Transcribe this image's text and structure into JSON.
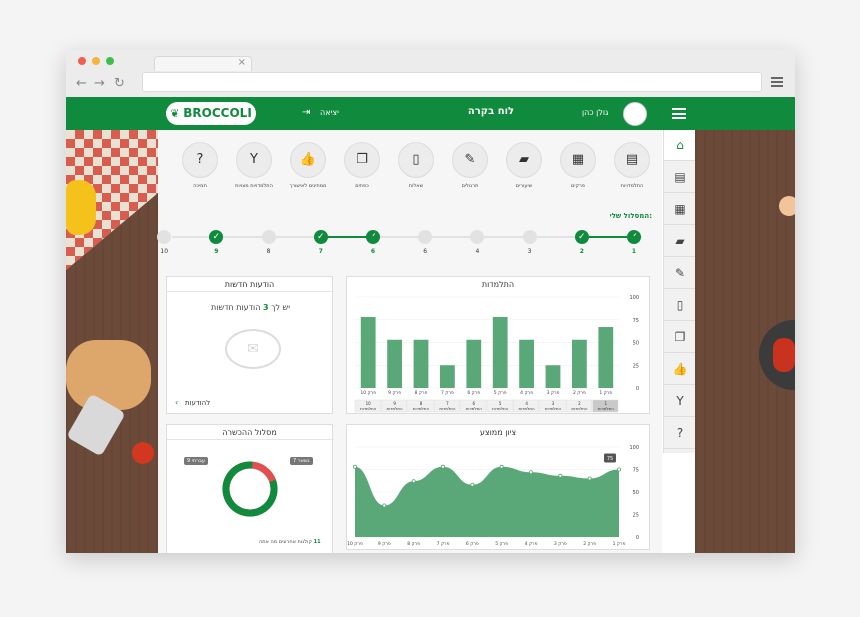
{
  "brand": {
    "name": "BROCCOLI",
    "color": "#108a3d"
  },
  "header": {
    "title": "לוח בקרה",
    "logout_label": "יציאה",
    "user_name": "גולן כהן"
  },
  "sidebar": {
    "icons": [
      "home-icon",
      "card-icon",
      "grid-icon",
      "book-icon",
      "edit-icon",
      "document-icon",
      "copy-icon",
      "thumbs-up-icon",
      "trophy-icon",
      "help-icon"
    ],
    "glyphs": [
      "⌂",
      "▤",
      "▦",
      "▰",
      "✎",
      "▯",
      "❐",
      "👍",
      "Y",
      "?"
    ]
  },
  "shortcuts": [
    {
      "label": "התלמדויות",
      "glyph": "▤"
    },
    {
      "label": "פרקים",
      "glyph": "▦"
    },
    {
      "label": "שיעורים",
      "glyph": "▰"
    },
    {
      "label": "תרגולים",
      "glyph": "✎"
    },
    {
      "label": "שאלות",
      "glyph": "▯"
    },
    {
      "label": "כפתים",
      "glyph": "❐"
    },
    {
      "label": "ממתינים לאישורך",
      "glyph": "👍"
    },
    {
      "label": "התלמדויות מצויות",
      "glyph": "Y"
    },
    {
      "label": "תמיכה",
      "glyph": "?"
    }
  ],
  "path": {
    "title": "המסלול שלי:",
    "steps": [
      {
        "label": "1",
        "done": true
      },
      {
        "label": "2",
        "done": true
      },
      {
        "label": "3",
        "done": false
      },
      {
        "label": "4",
        "done": false
      },
      {
        "label": "6",
        "done": false
      },
      {
        "label": "6",
        "done": true
      },
      {
        "label": "7",
        "done": true
      },
      {
        "label": "8",
        "done": false
      },
      {
        "label": "9",
        "done": true
      },
      {
        "label": "10",
        "done": false
      }
    ]
  },
  "messages": {
    "title": "הודעות חדשות",
    "prefix": "יש לך",
    "count": "3",
    "suffix": "הודעות חדשות",
    "link": "להודעות"
  },
  "bar_chart": {
    "title": "התלמדות",
    "categories": [
      "פרק 1",
      "פרק 2",
      "פרק 3",
      "פרק 4",
      "פרק 5",
      "פרק 6",
      "פרק 7",
      "פרק 8",
      "פרק 9",
      "פרק 10"
    ],
    "values": [
      67,
      53,
      25,
      53,
      78,
      53,
      25,
      53,
      53,
      78
    ],
    "yticks": [
      "100",
      "75",
      "50",
      "25",
      "0"
    ],
    "ylim": [
      0,
      100
    ],
    "tab_labels": [
      "1 התלמדות",
      "2 התלמדות",
      "3 התלמדות",
      "4 התלמדות",
      "5 התלמדות",
      "6 התלמדות",
      "7 התלמדות",
      "8 התלמדות",
      "9 התלמדות",
      "10 התלמדות"
    ]
  },
  "area_chart": {
    "title": "ציון ממוצע",
    "categories": [
      "פרק 1",
      "פרק 2",
      "פרק 3",
      "פרק 4",
      "פרק 5",
      "פרק 6",
      "פרק 7",
      "פרק 8",
      "פרק 9",
      "פרק 10"
    ],
    "values": [
      75,
      65,
      68,
      72,
      78,
      58,
      78,
      62,
      35,
      78
    ],
    "highlight": "75",
    "yticks": [
      "100",
      "75",
      "50",
      "25",
      "0"
    ],
    "ylim": [
      0,
      100
    ]
  },
  "training": {
    "title": "מסלול ההכשרה",
    "left_badge": "עברתי 9",
    "right_badge": "נשאר 7",
    "footer_count": "11",
    "footer_text": "קולגות אחרונים מה אתה",
    "done_fraction": 0.82,
    "colors": {
      "done": "#108a3d",
      "remaining": "#e05050"
    }
  },
  "chart_data": [
    {
      "type": "bar",
      "title": "התלמדות",
      "categories": [
        "פרק 1",
        "פרק 2",
        "פרק 3",
        "פרק 4",
        "פרק 5",
        "פרק 6",
        "פרק 7",
        "פרק 8",
        "פרק 9",
        "פרק 10"
      ],
      "values": [
        67,
        53,
        25,
        53,
        78,
        53,
        25,
        53,
        53,
        78
      ],
      "ylim": [
        0,
        100
      ]
    },
    {
      "type": "area",
      "title": "ציון ממוצע",
      "categories": [
        "פרק 1",
        "פרק 2",
        "פרק 3",
        "פרק 4",
        "פרק 5",
        "פרק 6",
        "פרק 7",
        "פרק 8",
        "פרק 9",
        "פרק 10"
      ],
      "values": [
        75,
        65,
        68,
        72,
        78,
        58,
        78,
        62,
        35,
        78
      ],
      "ylim": [
        0,
        100
      ]
    }
  ]
}
